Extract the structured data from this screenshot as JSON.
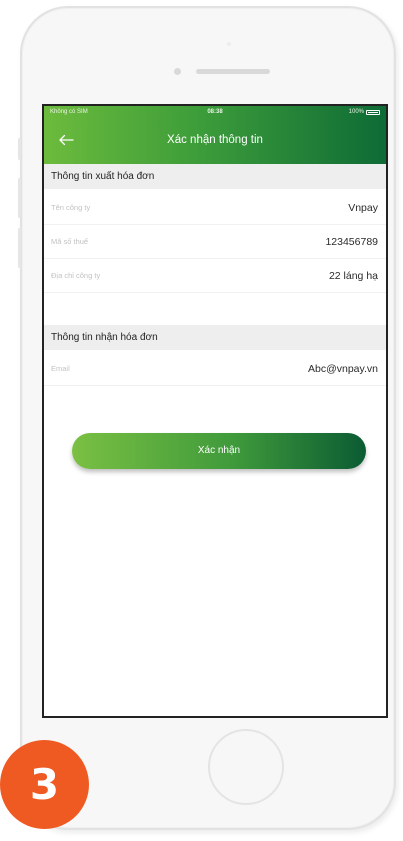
{
  "status_bar": {
    "carrier": "Không có SIM",
    "time": "08:38",
    "battery": "100%"
  },
  "header": {
    "back_icon": "arrow-left-icon",
    "title": "Xác nhận thông tin"
  },
  "invoice_info": {
    "section_title": "Thông tin xuất hóa đơn",
    "rows": [
      {
        "label": "Tên công ty",
        "value": "Vnpay"
      },
      {
        "label": "Mã số thuế",
        "value": "123456789"
      },
      {
        "label": "Địa chỉ công ty",
        "value": "22 láng hạ"
      }
    ]
  },
  "receive_info": {
    "section_title": "Thông tin nhận hóa đơn",
    "rows": [
      {
        "label": "Email",
        "value": "Abc@vnpay.vn"
      }
    ]
  },
  "confirm_button": {
    "label": "Xác nhận"
  },
  "step_badge": {
    "number": "3"
  },
  "colors": {
    "header_start": "#6cbb3c",
    "header_end": "#0e6b36",
    "badge": "#ef5a23"
  }
}
